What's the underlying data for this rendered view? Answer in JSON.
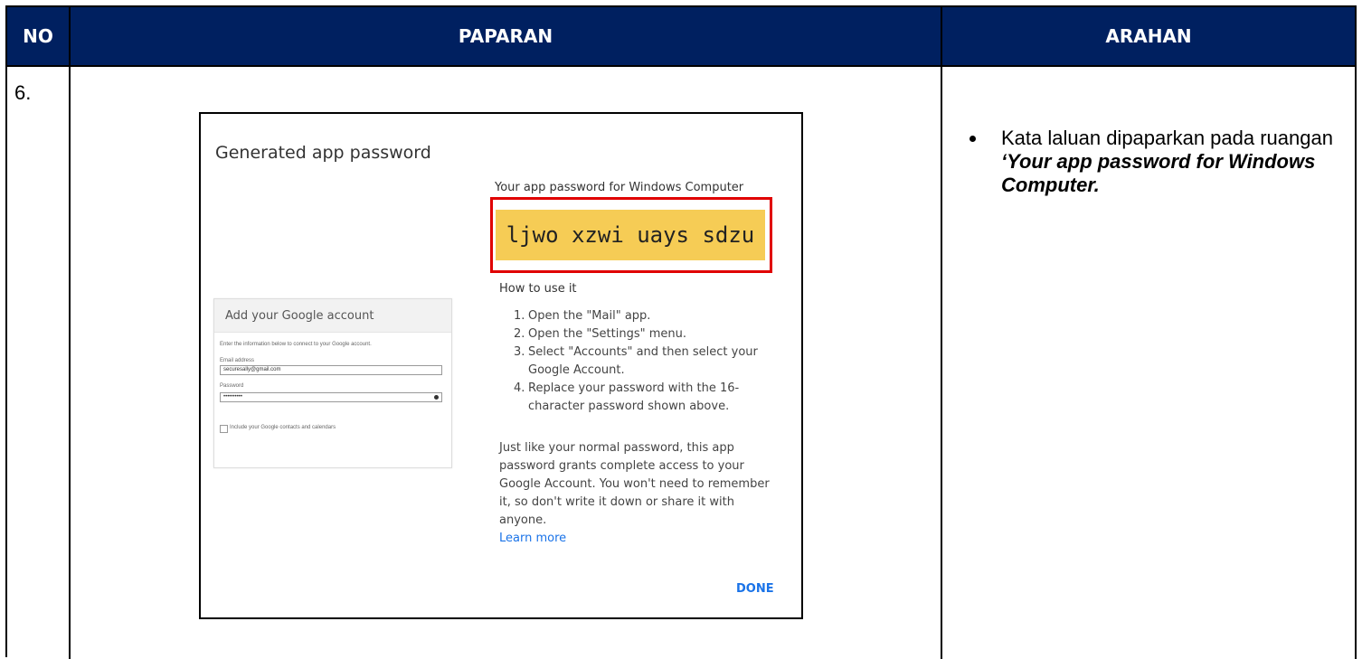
{
  "table": {
    "headers": {
      "no": "NO",
      "paparan": "PAPARAN",
      "arahan": "ARAHAN"
    },
    "header_bg": "#002060"
  },
  "row": {
    "number": "6."
  },
  "dialog": {
    "title": "Generated app password",
    "password_label": "Your app password for Windows Computer",
    "password": "ljwo xzwi uays sdzu",
    "highlight_color": "#f6cc55",
    "outline_color": "#e00000",
    "how_to_title": "How to use it",
    "steps": [
      {
        "n": "1.",
        "text": "Open the \"Mail\" app."
      },
      {
        "n": "2.",
        "text": "Open the \"Settings\" menu."
      },
      {
        "n": "3.",
        "text": "Select \"Accounts\" and then select your Google Account."
      },
      {
        "n": "4.",
        "text": "Replace your password with the 16-character password shown above."
      }
    ],
    "paragraph": "Just like your normal password, this app password grants complete access to your Google Account. You won't need to remember it, so don't write it down or share it with anyone.",
    "learn_more": "Learn more",
    "done": "DONE",
    "link_color": "#1a73e8"
  },
  "card": {
    "title": "Add your Google account",
    "subtitle": "Enter the information below to connect to your Google account.",
    "email_label": "Email address",
    "email_value": "securesally@gmail.com",
    "password_label": "Password",
    "password_value": "••••••••••",
    "checkbox_label": "Include your Google contacts and calendars"
  },
  "instruction": {
    "text_plain": "Kata laluan dipaparkan pada ruangan ",
    "text_emph": "‘Your app password for Windows Computer."
  }
}
